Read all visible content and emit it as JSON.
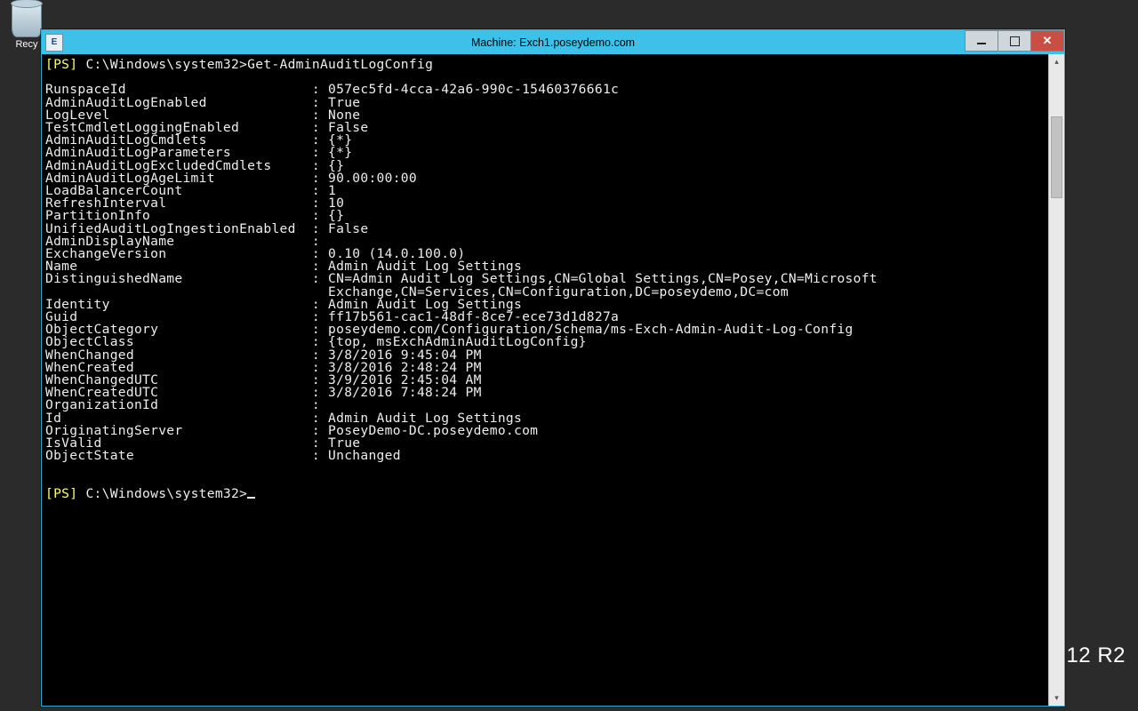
{
  "desktop": {
    "recycle_label": "Recy"
  },
  "window": {
    "title": "Machine: Exch1.poseydemo.com",
    "app_icon_text": "E"
  },
  "watermark": "12 R2",
  "prompt": {
    "bracket": "[PS]",
    "path": " C:\\Windows\\system32>",
    "command": "Get-AdminAuditLogConfig"
  },
  "output": [
    {
      "k": "RunspaceId",
      "v": "057ec5fd-4cca-42a6-990c-15460376661c"
    },
    {
      "k": "AdminAuditLogEnabled",
      "v": "True"
    },
    {
      "k": "LogLevel",
      "v": "None"
    },
    {
      "k": "TestCmdletLoggingEnabled",
      "v": "False"
    },
    {
      "k": "AdminAuditLogCmdlets",
      "v": "{*}"
    },
    {
      "k": "AdminAuditLogParameters",
      "v": "{*}"
    },
    {
      "k": "AdminAuditLogExcludedCmdlets",
      "v": "{}"
    },
    {
      "k": "AdminAuditLogAgeLimit",
      "v": "90.00:00:00"
    },
    {
      "k": "LoadBalancerCount",
      "v": "1"
    },
    {
      "k": "RefreshInterval",
      "v": "10"
    },
    {
      "k": "PartitionInfo",
      "v": "{}"
    },
    {
      "k": "UnifiedAuditLogIngestionEnabled",
      "v": "False"
    },
    {
      "k": "AdminDisplayName",
      "v": ""
    },
    {
      "k": "ExchangeVersion",
      "v": "0.10 (14.0.100.0)"
    },
    {
      "k": "Name",
      "v": "Admin Audit Log Settings"
    },
    {
      "k": "DistinguishedName",
      "v": "CN=Admin Audit Log Settings,CN=Global Settings,CN=Posey,CN=Microsoft\n                                   Exchange,CN=Services,CN=Configuration,DC=poseydemo,DC=com"
    },
    {
      "k": "Identity",
      "v": "Admin Audit Log Settings"
    },
    {
      "k": "Guid",
      "v": "ff17b561-cac1-48df-8ce7-ece73d1d827a"
    },
    {
      "k": "ObjectCategory",
      "v": "poseydemo.com/Configuration/Schema/ms-Exch-Admin-Audit-Log-Config"
    },
    {
      "k": "ObjectClass",
      "v": "{top, msExchAdminAuditLogConfig}"
    },
    {
      "k": "WhenChanged",
      "v": "3/8/2016 9:45:04 PM"
    },
    {
      "k": "WhenCreated",
      "v": "3/8/2016 2:48:24 PM"
    },
    {
      "k": "WhenChangedUTC",
      "v": "3/9/2016 2:45:04 AM"
    },
    {
      "k": "WhenCreatedUTC",
      "v": "3/8/2016 7:48:24 PM"
    },
    {
      "k": "OrganizationId",
      "v": ""
    },
    {
      "k": "Id",
      "v": "Admin Audit Log Settings"
    },
    {
      "k": "OriginatingServer",
      "v": "PoseyDemo-DC.poseydemo.com"
    },
    {
      "k": "IsValid",
      "v": "True"
    },
    {
      "k": "ObjectState",
      "v": "Unchanged"
    }
  ],
  "keyWidth": 32
}
